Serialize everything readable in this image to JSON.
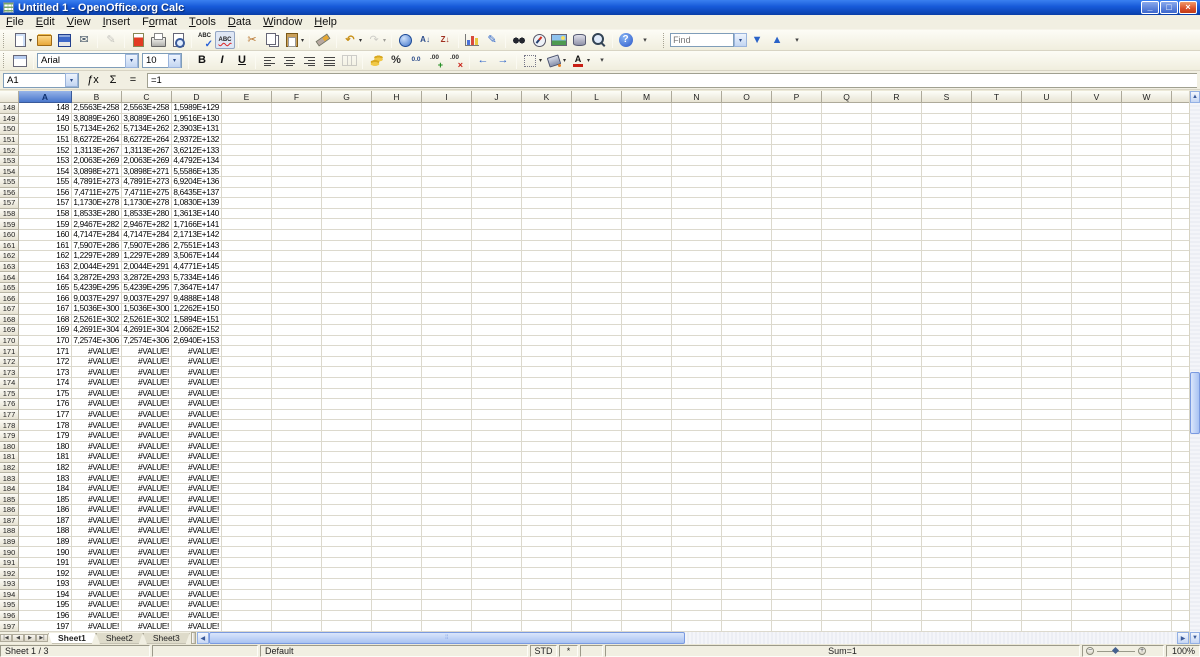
{
  "window": {
    "title": "Untitled 1 - OpenOffice.org Calc",
    "buttons": [
      {
        "n": "minimize-button",
        "g": "_"
      },
      {
        "n": "restore-button",
        "g": "□"
      },
      {
        "n": "close-button",
        "g": "×",
        "close": true
      }
    ]
  },
  "menu": {
    "items": [
      {
        "label": "File",
        "u": 0
      },
      {
        "label": "Edit",
        "u": 0
      },
      {
        "label": "View",
        "u": 0
      },
      {
        "label": "Insert",
        "u": 0
      },
      {
        "label": "Format",
        "u": 1
      },
      {
        "label": "Tools",
        "u": 0
      },
      {
        "label": "Data",
        "u": 0
      },
      {
        "label": "Window",
        "u": 0
      },
      {
        "label": "Help",
        "u": 0
      }
    ]
  },
  "toolbar_standard": [
    {
      "n": "new-document-button",
      "cls": "ic-page",
      "dd": true
    },
    {
      "n": "open-button",
      "cls": "ic-folder"
    },
    {
      "n": "save-button",
      "cls": "ic-floppy"
    },
    {
      "n": "document-as-email-button",
      "g": "✉",
      "col": "#445566"
    },
    {
      "t": "s"
    },
    {
      "n": "edit-file-button",
      "g": "✎",
      "col": "#888",
      "dis": true
    },
    {
      "t": "s"
    },
    {
      "n": "export-pdf-button",
      "cls": "ic-pdf"
    },
    {
      "n": "print-button",
      "cls": "ic-print"
    },
    {
      "n": "page-preview-button",
      "cls": "ic-preview"
    },
    {
      "t": "s"
    },
    {
      "n": "spellcheck-button",
      "cls": "ic-spell"
    },
    {
      "n": "autospellcheck-button",
      "cls": "ic-autospell",
      "act": true
    },
    {
      "t": "s"
    },
    {
      "n": "cut-button",
      "g": "✂",
      "col": "#b36a1e"
    },
    {
      "n": "copy-button",
      "cls": "ic-copy"
    },
    {
      "n": "paste-button",
      "cls": "ic-paste",
      "dd": true
    },
    {
      "t": "s"
    },
    {
      "n": "format-paintbrush-button",
      "cls": "ic-brush"
    },
    {
      "t": "s"
    },
    {
      "n": "undo-button",
      "g": "↶",
      "col": "#c89018",
      "b": true,
      "dd": true
    },
    {
      "n": "redo-button",
      "g": "↷",
      "col": "#999",
      "dd": true,
      "dis": true
    },
    {
      "t": "s"
    },
    {
      "n": "hyperlink-button",
      "cls": "ic-globe"
    },
    {
      "n": "sort-ascending-button",
      "g": "A↓",
      "fs": 8,
      "b": true,
      "col": "#2a4a8a"
    },
    {
      "n": "sort-descending-button",
      "g": "Z↓",
      "fs": 8,
      "b": true,
      "col": "#a03020"
    },
    {
      "t": "s"
    },
    {
      "n": "insert-chart-button",
      "cls": "ic-chart"
    },
    {
      "n": "show-draw-functions-button",
      "g": "✎",
      "col": "#2a62c8"
    },
    {
      "t": "s"
    },
    {
      "n": "find-replace-button",
      "cls": "ic-binoc"
    },
    {
      "n": "navigator-button",
      "cls": "ic-compass"
    },
    {
      "n": "gallery-button",
      "cls": "ic-gallery"
    },
    {
      "n": "data-sources-button",
      "cls": "ic-db"
    },
    {
      "n": "zoom-button",
      "cls": "ic-zoomglass"
    },
    {
      "t": "s"
    },
    {
      "n": "help-button",
      "g": "?",
      "cls": "ic-help"
    },
    {
      "n": "toolbar-options-arrow",
      "g": "▾",
      "fs": 7,
      "col": "#444"
    }
  ],
  "find_toolbar": {
    "placeholder": "Find",
    "buttons": [
      {
        "n": "find-next-button",
        "g": "▼",
        "col": "#2a62c8"
      },
      {
        "n": "find-previous-button",
        "g": "▲",
        "col": "#2a62c8"
      },
      {
        "n": "toolbar-options-arrow",
        "g": "▾",
        "fs": 7,
        "col": "#444"
      }
    ]
  },
  "toolbar_formatting": {
    "font_name": "Arial",
    "font_size": "10",
    "left": [
      {
        "n": "styles-formatting-button",
        "cls": "ic-styles"
      },
      {
        "t": "s"
      }
    ],
    "buttons": [
      {
        "t": "s"
      },
      {
        "n": "bold-button",
        "g": "B",
        "b": true,
        "col": "#111"
      },
      {
        "n": "italic-button",
        "g": "I",
        "i": true,
        "b": true,
        "col": "#111"
      },
      {
        "n": "underline-button",
        "g": "U",
        "u2": true,
        "b": true,
        "col": "#111"
      },
      {
        "t": "s"
      },
      {
        "n": "align-left-button",
        "cls": "ic-al"
      },
      {
        "n": "align-center-button",
        "cls": "ic-ac"
      },
      {
        "n": "align-right-button",
        "cls": "ic-ar"
      },
      {
        "n": "align-justify-button",
        "cls": "ic-aj"
      },
      {
        "n": "merge-cells-button",
        "cls": "ic-merge",
        "dis": true
      },
      {
        "t": "s"
      },
      {
        "n": "number-format-currency-button",
        "cls": "ic-coins"
      },
      {
        "n": "number-format-percent-button",
        "g": "%",
        "b": true,
        "col": "#333"
      },
      {
        "n": "number-format-standard-button",
        "cls": "ic-numstd"
      },
      {
        "n": "add-decimal-place-button",
        "cls": "ic-adddec"
      },
      {
        "n": "delete-decimal-place-button",
        "cls": "ic-deldec"
      },
      {
        "t": "s"
      },
      {
        "n": "decrease-indent-button",
        "g": "←",
        "col": "#2a62c8",
        "b": true
      },
      {
        "n": "increase-indent-button",
        "g": "→",
        "col": "#2a62c8",
        "b": true
      },
      {
        "t": "s"
      },
      {
        "n": "borders-button",
        "cls": "ic-borders",
        "dd": true
      },
      {
        "n": "background-color-button",
        "cls": "ic-bucket",
        "dd": true
      },
      {
        "n": "font-color-button",
        "cls": "ic-fontcolor",
        "dd": true
      },
      {
        "n": "toolbar-options-arrow",
        "g": "▾",
        "fs": 7,
        "col": "#444"
      }
    ]
  },
  "formula_bar": {
    "cell_ref": "A1",
    "formula": "=1",
    "buttons": [
      {
        "n": "function-wizard-button",
        "g": "ƒx"
      },
      {
        "n": "sum-button",
        "g": "Σ"
      },
      {
        "n": "formula-button",
        "g": "="
      }
    ]
  },
  "grid": {
    "columns": [
      "A",
      "B",
      "C",
      "D",
      "E",
      "F",
      "G",
      "H",
      "I",
      "J",
      "K",
      "L",
      "M",
      "N",
      "O",
      "P",
      "Q",
      "R",
      "S",
      "T",
      "U",
      "V",
      "W"
    ],
    "selected_column": "A",
    "first_visible_row": 148,
    "last_visible_row": 197,
    "rows": [
      {
        "r": 148,
        "a": "148",
        "b": "2,5563E+258",
        "c": "2,5563E+258",
        "d": "1,5989E+129"
      },
      {
        "r": 149,
        "a": "149",
        "b": "3,8089E+260",
        "c": "3,8089E+260",
        "d": "1,9516E+130"
      },
      {
        "r": 150,
        "a": "150",
        "b": "5,7134E+262",
        "c": "5,7134E+262",
        "d": "2,3903E+131"
      },
      {
        "r": 151,
        "a": "151",
        "b": "8,6272E+264",
        "c": "8,6272E+264",
        "d": "2,9372E+132"
      },
      {
        "r": 152,
        "a": "152",
        "b": "1,3113E+267",
        "c": "1,3113E+267",
        "d": "3,6212E+133"
      },
      {
        "r": 153,
        "a": "153",
        "b": "2,0063E+269",
        "c": "2,0063E+269",
        "d": "4,4792E+134"
      },
      {
        "r": 154,
        "a": "154",
        "b": "3,0898E+271",
        "c": "3,0898E+271",
        "d": "5,5586E+135"
      },
      {
        "r": 155,
        "a": "155",
        "b": "4,7891E+273",
        "c": "4,7891E+273",
        "d": "6,9204E+136"
      },
      {
        "r": 156,
        "a": "156",
        "b": "7,4711E+275",
        "c": "7,4711E+275",
        "d": "8,6435E+137"
      },
      {
        "r": 157,
        "a": "157",
        "b": "1,1730E+278",
        "c": "1,1730E+278",
        "d": "1,0830E+139"
      },
      {
        "r": 158,
        "a": "158",
        "b": "1,8533E+280",
        "c": "1,8533E+280",
        "d": "1,3613E+140"
      },
      {
        "r": 159,
        "a": "159",
        "b": "2,9467E+282",
        "c": "2,9467E+282",
        "d": "1,7166E+141"
      },
      {
        "r": 160,
        "a": "160",
        "b": "4,7147E+284",
        "c": "4,7147E+284",
        "d": "2,1713E+142"
      },
      {
        "r": 161,
        "a": "161",
        "b": "7,5907E+286",
        "c": "7,5907E+286",
        "d": "2,7551E+143"
      },
      {
        "r": 162,
        "a": "162",
        "b": "1,2297E+289",
        "c": "1,2297E+289",
        "d": "3,5067E+144"
      },
      {
        "r": 163,
        "a": "163",
        "b": "2,0044E+291",
        "c": "2,0044E+291",
        "d": "4,4771E+145"
      },
      {
        "r": 164,
        "a": "164",
        "b": "3,2872E+293",
        "c": "3,2872E+293",
        "d": "5,7334E+146"
      },
      {
        "r": 165,
        "a": "165",
        "b": "5,4239E+295",
        "c": "5,4239E+295",
        "d": "7,3647E+147"
      },
      {
        "r": 166,
        "a": "166",
        "b": "9,0037E+297",
        "c": "9,0037E+297",
        "d": "9,4888E+148"
      },
      {
        "r": 167,
        "a": "167",
        "b": "1,5036E+300",
        "c": "1,5036E+300",
        "d": "1,2262E+150"
      },
      {
        "r": 168,
        "a": "168",
        "b": "2,5261E+302",
        "c": "2,5261E+302",
        "d": "1,5894E+151"
      },
      {
        "r": 169,
        "a": "169",
        "b": "4,2691E+304",
        "c": "4,2691E+304",
        "d": "2,0662E+152"
      },
      {
        "r": 170,
        "a": "170",
        "b": "7,2574E+306",
        "c": "7,2574E+306",
        "d": "2,6940E+153"
      }
    ],
    "error_rows": {
      "from": 171,
      "to": 197,
      "value": "#VALUE!"
    }
  },
  "sheet_bar": {
    "nav": [
      {
        "n": "first-sheet-button",
        "g": "|◀"
      },
      {
        "n": "previous-sheet-button",
        "g": "◀"
      },
      {
        "n": "next-sheet-button",
        "g": "▶"
      },
      {
        "n": "last-sheet-button",
        "g": "▶|"
      }
    ],
    "tabs": [
      "Sheet1",
      "Sheet2",
      "Sheet3"
    ],
    "active": "Sheet1"
  },
  "status_bar": {
    "sheet": "Sheet 1 / 3",
    "page_style": "Default",
    "mode": "STD",
    "modified": "*",
    "sum": "Sum=1",
    "zoom": "100%"
  }
}
